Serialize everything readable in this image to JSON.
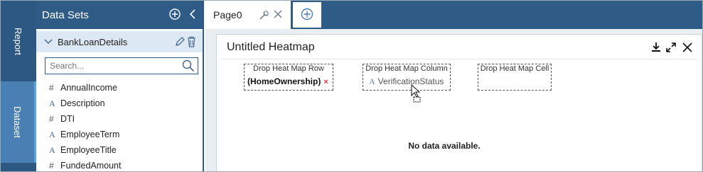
{
  "rail": {
    "report_label": "Report",
    "dataset_label": "Dataset"
  },
  "datasets": {
    "title": "Data Sets",
    "item_name": "BankLoanDetails",
    "search_placeholder": "Search...",
    "fields": [
      {
        "icon": "#",
        "name": "AnnualIncome"
      },
      {
        "icon": "A",
        "name": "Description"
      },
      {
        "icon": "#",
        "name": "DTI"
      },
      {
        "icon": "A",
        "name": "EmployeeTerm"
      },
      {
        "icon": "A",
        "name": "EmployeeTitle"
      },
      {
        "icon": "#",
        "name": "FundedAmount"
      }
    ]
  },
  "tabs": {
    "page_name": "Page0"
  },
  "widget": {
    "title": "Untitled Heatmap",
    "drop_row_label": "Drop Heat Map Row",
    "row_value": "(HomeOwnership)",
    "row_remove": "×",
    "drop_column_label": "Drop Heat Map Column",
    "column_icon": "A",
    "column_value": "VerificationStatus",
    "drop_cell_label": "Drop Heat Map Cell",
    "no_data": "No data available."
  },
  "colors": {
    "primary": "#2f5b87",
    "selected_rail": "#4a7fb3",
    "selected_item": "#dce8f4"
  }
}
